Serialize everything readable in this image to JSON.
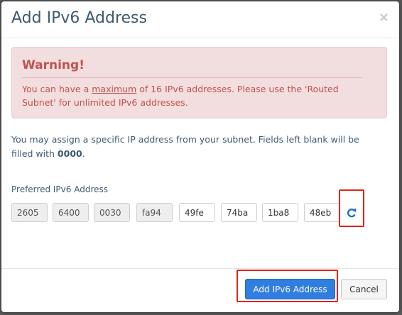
{
  "dialog": {
    "title": "Add IPv6 Address",
    "close_glyph": "×"
  },
  "alert": {
    "heading": "Warning!",
    "text_pre": "You can have a ",
    "text_emph": "maximum",
    "text_post": " of 16 IPv6 addresses. Please use the 'Routed Subnet' for unlimited IPv6 addresses."
  },
  "info": {
    "text_pre": "You may assign a specific IP address from your subnet. Fields left blank will be filled with ",
    "text_bold": "0000",
    "text_post": "."
  },
  "address_field": {
    "label": "Preferred IPv6 Address",
    "segments": [
      "2605",
      "6400",
      "0030",
      "fa94",
      "49fe",
      "74ba",
      "1ba8",
      "48eb"
    ],
    "locked_segments": 4,
    "refresh_icon": "refresh-icon"
  },
  "footer": {
    "submit_label": "Add IPv6 Address",
    "cancel_label": "Cancel"
  },
  "colors": {
    "title": "#3d5a73",
    "alert_bg": "#f2dede",
    "alert_text": "#c0524f",
    "primary": "#2f7ee0",
    "annotation": "#e2231a"
  }
}
